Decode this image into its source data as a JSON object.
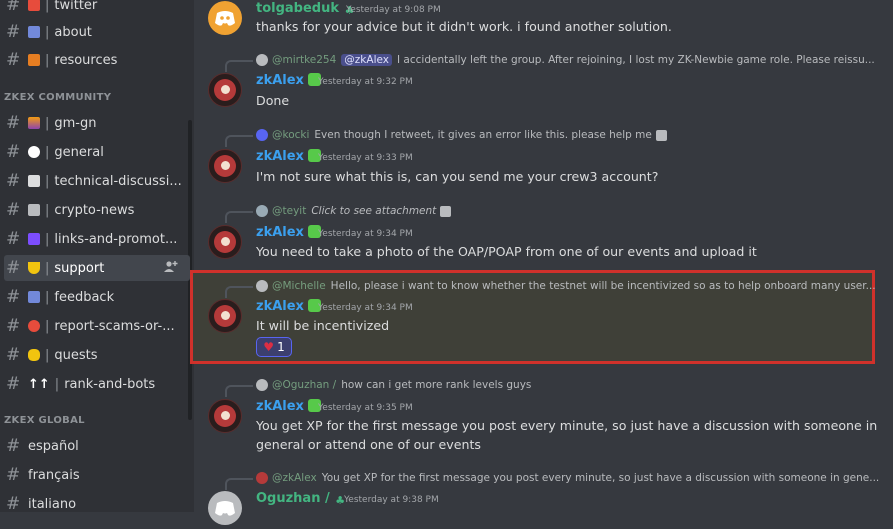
{
  "sidebar": {
    "top_channels": [
      {
        "name": "twitter",
        "emoji_color": "#e74c3c"
      },
      {
        "name": "about",
        "emoji_color": "#7289da"
      },
      {
        "name": "resources",
        "emoji_color": "#e67e22"
      }
    ],
    "categories": {
      "community": "ZKEX COMMUNITY",
      "global": "ZKEX GLOBAL"
    },
    "community_channels": [
      {
        "name": "gm-gn",
        "emoji_color": "#f39c12"
      },
      {
        "name": "general",
        "emoji_color": "#ffffff"
      },
      {
        "name": "technical-discussi...",
        "emoji_color": "#dcddde"
      },
      {
        "name": "crypto-news",
        "emoji_color": "#b9bbbe"
      },
      {
        "name": "links-and-promot...",
        "emoji_color": "#7c4dff"
      },
      {
        "name": "support",
        "emoji_color": "#f1c40f",
        "selected": true
      },
      {
        "name": "feedback",
        "emoji_color": "#7289da"
      },
      {
        "name": "report-scams-or-...",
        "emoji_color": "#e74c3c"
      },
      {
        "name": "quests",
        "emoji_color": "#f1c40f"
      },
      {
        "name": "rank-and-bots",
        "emoji_text": "↑↑"
      }
    ],
    "global_channels": [
      {
        "name": "español"
      },
      {
        "name": "français"
      },
      {
        "name": "italiano"
      }
    ]
  },
  "messages": [
    {
      "author": "tolgabeduk",
      "author_color": "#43b581",
      "timestamp": "Yesterday at 9:08 PM",
      "text": "thanks for your advice but it didn't work. i found another solution."
    },
    {
      "reply_name": "@mirtke254",
      "reply_mention": "@zkAlex",
      "reply_text": "I accidentally left the group. After rejoining, I lost my ZK-Newbie game role. Please reissu...",
      "author": "zkAlex",
      "author_color": "#3ba0ef",
      "timestamp": "Yesterday at 9:32 PM",
      "text": "Done"
    },
    {
      "reply_name": "@kocki",
      "reply_text": "Even though I retweet, it gives an error like this.  please help me",
      "author": "zkAlex",
      "author_color": "#3ba0ef",
      "timestamp": "Yesterday at 9:33 PM",
      "text": "I'm not sure what this is, can you send me your crew3 account?"
    },
    {
      "reply_name": "@teyit",
      "reply_text": "Click to see attachment",
      "author": "zkAlex",
      "author_color": "#3ba0ef",
      "timestamp": "Yesterday at 9:34 PM",
      "text": "You need to take a photo of the OAP/POAP from one of our events and upload it"
    },
    {
      "reply_name": "@Michelle",
      "reply_text": "Hello, please i want to know whether the testnet will be incentivized so as to help onboard many user...",
      "author": "zkAlex",
      "author_color": "#3ba0ef",
      "timestamp": "Yesterday at 9:34 PM",
      "text": "It will be incentivized",
      "reaction": {
        "emoji": "♥",
        "count": "1"
      }
    },
    {
      "reply_name": "@Oguzhan /",
      "reply_text": "how can i get more rank levels guys",
      "author": "zkAlex",
      "author_color": "#3ba0ef",
      "timestamp": "Yesterday at 9:35 PM",
      "text": "You get XP for the first message you post every minute, so just have a discussion with someone in",
      "text2": "general or attend one of our events"
    },
    {
      "reply_name": "@zkAlex",
      "reply_text": "You get XP for the first message you post every minute, so just have a discussion with someone in gene...",
      "author": "Oguzhan /",
      "author_color": "#43b581",
      "timestamp": "Yesterday at 9:38 PM"
    }
  ]
}
